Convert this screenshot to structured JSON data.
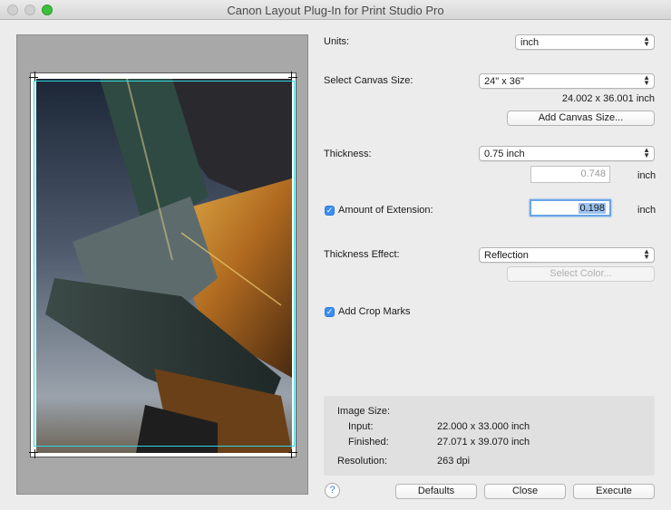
{
  "window": {
    "title": "Canon Layout Plug-In for Print Studio Pro"
  },
  "units": {
    "label": "Units:",
    "value": "inch"
  },
  "canvas": {
    "label": "Select Canvas Size:",
    "value": "24\" x 36\"",
    "dims": "24.002 x 36.001 inch",
    "add_button": "Add Canvas Size..."
  },
  "thickness": {
    "label": "Thickness:",
    "value": "0.75 inch",
    "field": "0.748",
    "unit": "inch"
  },
  "extension": {
    "label": "Amount of Extension:",
    "checked": true,
    "value": "0.198",
    "unit": "inch"
  },
  "effect": {
    "label": "Thickness Effect:",
    "value": "Reflection",
    "color_button": "Select Color..."
  },
  "crop_marks": {
    "label": "Add Crop Marks",
    "checked": true
  },
  "image_size": {
    "heading": "Image Size:",
    "input_label": "Input:",
    "input_value": "22.000 x 33.000 inch",
    "finished_label": "Finished:",
    "finished_value": "27.071 x 39.070 inch",
    "resolution_label": "Resolution:",
    "resolution_value": "263 dpi"
  },
  "buttons": {
    "help": "?",
    "defaults": "Defaults",
    "close": "Close",
    "execute": "Execute"
  },
  "colors": {
    "guide": "#2fd6e0",
    "accent": "#3b8ef4",
    "zoom": "#3ebe3e"
  }
}
